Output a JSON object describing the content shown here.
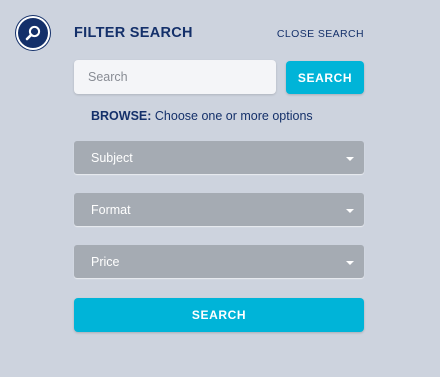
{
  "header": {
    "icon": "magnifier-icon",
    "title": "FILTER SEARCH",
    "close_label": "CLOSE SEARCH"
  },
  "search": {
    "placeholder": "Search",
    "value": "",
    "button_label": "SEARCH"
  },
  "browse": {
    "label": "BROWSE:",
    "hint": "Choose one or more options"
  },
  "filters": [
    {
      "label": "Subject",
      "icon": "caret-down-icon"
    },
    {
      "label": "Format",
      "icon": "caret-down-icon"
    },
    {
      "label": "Price",
      "icon": "caret-down-icon"
    }
  ],
  "submit": {
    "label": "SEARCH"
  },
  "colors": {
    "background": "#cdd3de",
    "brand_navy": "#14306a",
    "accent_cyan": "#00b4d8",
    "select_gray": "#a5abb3"
  }
}
